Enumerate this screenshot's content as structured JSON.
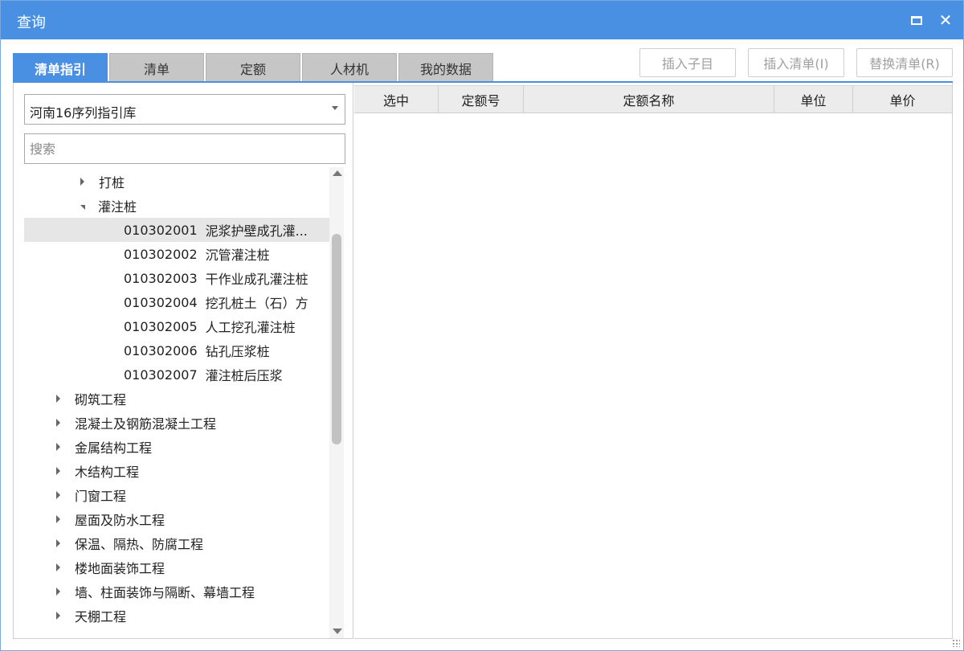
{
  "window": {
    "title": "查询"
  },
  "tabs": [
    {
      "label": "清单指引",
      "active": true
    },
    {
      "label": "清单",
      "active": false
    },
    {
      "label": "定额",
      "active": false
    },
    {
      "label": "人材机",
      "active": false
    },
    {
      "label": "我的数据",
      "active": false
    }
  ],
  "toolbar": {
    "insert_child": "插入子目",
    "insert_list": "插入清单(I)",
    "replace_list": "替换清单(R)"
  },
  "library_select": {
    "value": "河南16序列指引库"
  },
  "search": {
    "placeholder": "搜索"
  },
  "tree": [
    {
      "label": "打桩",
      "state": "collapsed",
      "level": 1
    },
    {
      "label": "灌注桩",
      "state": "expanded",
      "level": 1
    },
    {
      "code": "010302001",
      "label": "泥浆护壁成孔灌...",
      "level": 2,
      "selected": true
    },
    {
      "code": "010302002",
      "label": "沉管灌注桩",
      "level": 2
    },
    {
      "code": "010302003",
      "label": "干作业成孔灌注桩",
      "level": 2
    },
    {
      "code": "010302004",
      "label": "挖孔桩土（石）方",
      "level": 2
    },
    {
      "code": "010302005",
      "label": "人工挖孔灌注桩",
      "level": 2
    },
    {
      "code": "010302006",
      "label": "钻孔压浆桩",
      "level": 2
    },
    {
      "code": "010302007",
      "label": "灌注桩后压浆",
      "level": 2
    },
    {
      "label": "砌筑工程",
      "state": "collapsed",
      "level": 0
    },
    {
      "label": "混凝土及钢筋混凝土工程",
      "state": "collapsed",
      "level": 0
    },
    {
      "label": "金属结构工程",
      "state": "collapsed",
      "level": 0
    },
    {
      "label": "木结构工程",
      "state": "collapsed",
      "level": 0
    },
    {
      "label": "门窗工程",
      "state": "collapsed",
      "level": 0
    },
    {
      "label": "屋面及防水工程",
      "state": "collapsed",
      "level": 0
    },
    {
      "label": "保温、隔热、防腐工程",
      "state": "collapsed",
      "level": 0
    },
    {
      "label": "楼地面装饰工程",
      "state": "collapsed",
      "level": 0
    },
    {
      "label": "墙、柱面装饰与隔断、幕墙工程",
      "state": "collapsed",
      "level": 0
    },
    {
      "label": "天棚工程",
      "state": "collapsed",
      "level": 0
    }
  ],
  "grid": {
    "columns": [
      "选中",
      "定额号",
      "定额名称",
      "单位",
      "单价"
    ]
  },
  "colors": {
    "accent": "#4a90e2",
    "tab_inactive": "#c6c6c6",
    "selected_row": "#e6e6e6"
  }
}
